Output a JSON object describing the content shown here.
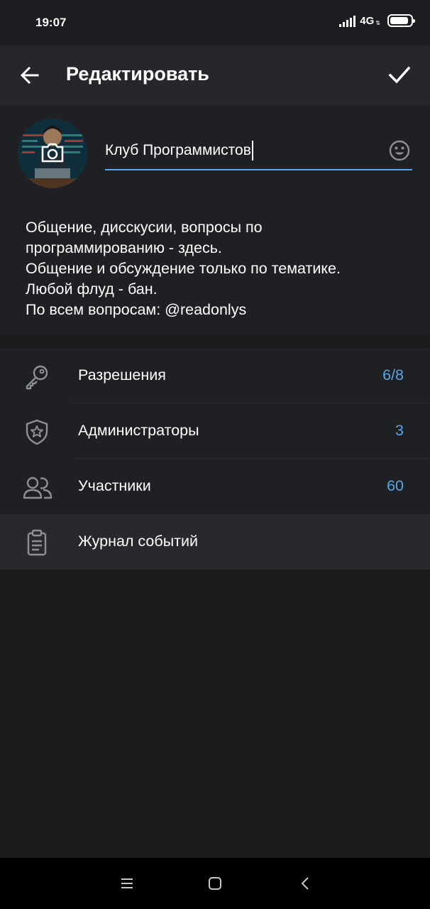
{
  "status_bar": {
    "time": "19:07",
    "network": "4G",
    "network_arrows": "⇅",
    "battery_level": 0.9
  },
  "app_bar": {
    "title": "Редактировать",
    "back_icon": "arrow-left-icon",
    "confirm_icon": "checkmark-icon"
  },
  "profile": {
    "name_value": "Клуб Программистов",
    "description": "Общение, дисскусии, вопросы по\nпрограммированию - здесь.\nОбщение и обсуждение только по тематике.\nЛюбой флуд - бан.\nПо всем вопросам: @readonlys"
  },
  "menu": {
    "items": [
      {
        "label": "Разрешения",
        "count": "6/8",
        "icon": "key-icon"
      },
      {
        "label": "Администраторы",
        "count": "3",
        "icon": "shield-star-icon"
      },
      {
        "label": "Участники",
        "count": "60",
        "icon": "users-icon"
      },
      {
        "label": "Журнал событий",
        "count": "",
        "icon": "clipboard-icon"
      }
    ]
  },
  "colors": {
    "accent": "#5aa6e4",
    "background": "#1b1c1e",
    "app_bar": "#25272b",
    "section": "#1f2023"
  }
}
